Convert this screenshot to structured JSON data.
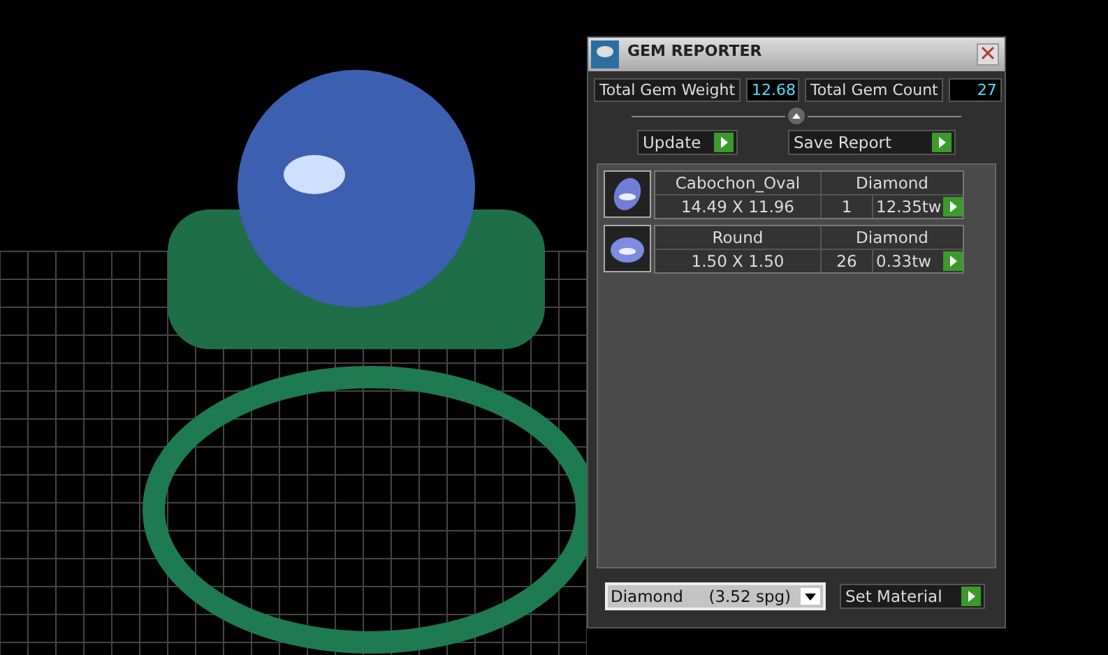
{
  "window": {
    "title": "GEM REPORTER"
  },
  "totals": [
    {
      "label": "Total Gem Weight",
      "value": "12.68"
    },
    {
      "label": "Total Gem Count",
      "value": "27"
    }
  ],
  "actions": [
    {
      "label": "Update"
    },
    {
      "label": "Save Report"
    }
  ],
  "gems": [
    {
      "kind": "oval",
      "shape": "Cabochon_Oval",
      "material": "Diamond",
      "size": "14.49 X 11.96",
      "count": "1",
      "weight": "12.35tw"
    },
    {
      "kind": "round",
      "shape": "Round",
      "material": "Diamond",
      "size": "1.50 X 1.50",
      "count": "26",
      "weight": "0.33tw"
    }
  ],
  "material_select": {
    "value": "Diamond     (3.52 spg)"
  },
  "set_material": {
    "label": "Set Material"
  }
}
